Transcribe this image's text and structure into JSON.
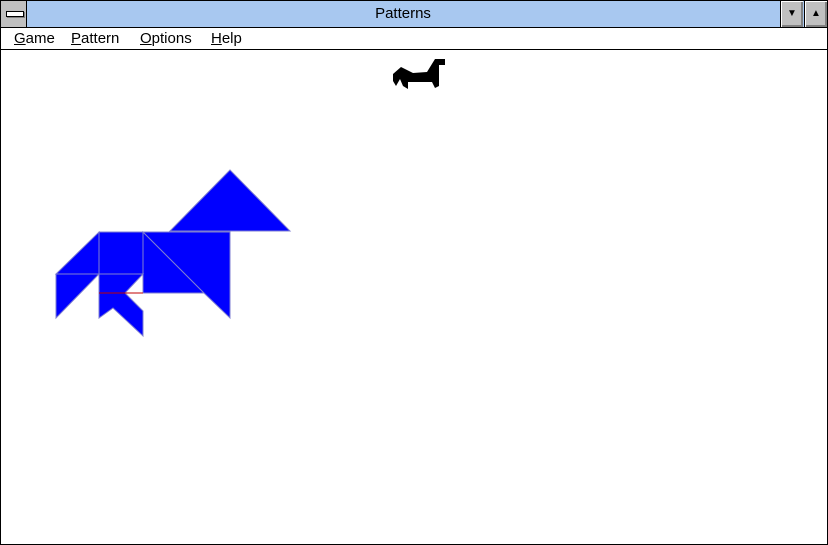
{
  "window": {
    "title": "Patterns",
    "sys_menu_icon": "minus-bar-icon",
    "minimize_glyph": "▼",
    "maximize_glyph": "▲"
  },
  "menu": {
    "items": [
      {
        "label": "Game",
        "accel_first": "G",
        "rest": "ame"
      },
      {
        "label": "Pattern",
        "accel_first": "P",
        "rest": "attern"
      },
      {
        "label": "Options",
        "accel_first": "O",
        "rest": "ptions"
      },
      {
        "label": "Help",
        "accel_first": "H",
        "rest": "elp"
      }
    ]
  },
  "colors": {
    "titlebar": "#a8c8f0",
    "piece_fill": "#0000ff",
    "piece_edge": "#7f7fd0",
    "target_fill": "#000000",
    "accent_line": "#c00000"
  },
  "puzzle": {
    "target_shape_name": "horse-silhouette",
    "pieces_shape_name": "tangram-horse"
  }
}
